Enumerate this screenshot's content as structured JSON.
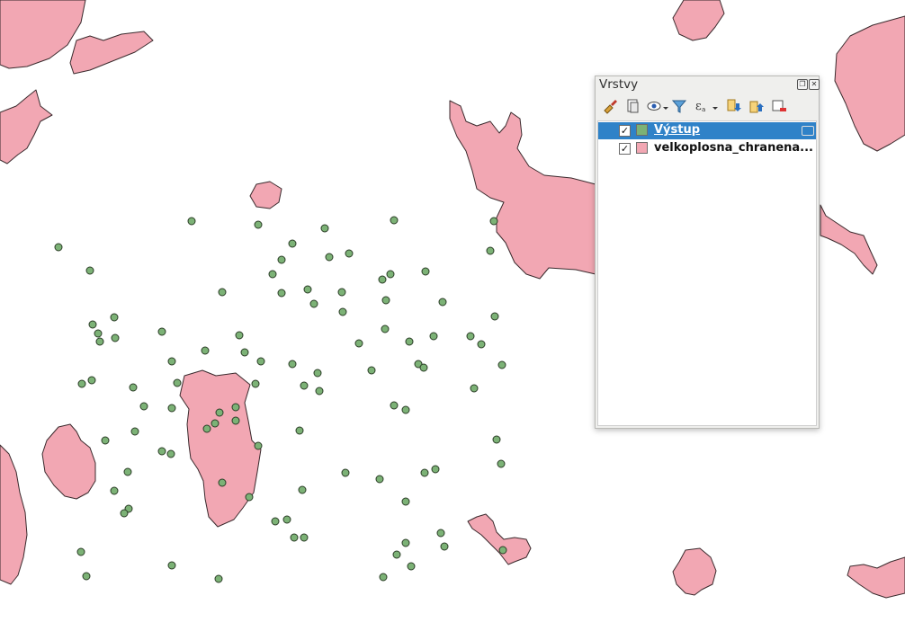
{
  "panel": {
    "title": "Vrstvy",
    "float_icon": "float-icon",
    "close_icon": "close-icon"
  },
  "toolbar": {
    "icons": [
      "style-brush-icon",
      "add-group-icon",
      "visibility-eye-icon",
      "filter-icon",
      "expression-filter-icon",
      "expand-all-icon",
      "collapse-all-icon",
      "remove-layer-icon"
    ]
  },
  "layers": [
    {
      "name": "Výstup",
      "checked": "✓",
      "symbol_color": "#7cb276",
      "selected": true
    },
    {
      "name": "velkoplosna_chranena...",
      "checked": "✓",
      "symbol_color": "#f2a7b3",
      "selected": false
    }
  ],
  "colors": {
    "polygon_fill": "#f2a7b3",
    "point_fill": "#7cb276",
    "selection": "#2f82c8"
  }
}
